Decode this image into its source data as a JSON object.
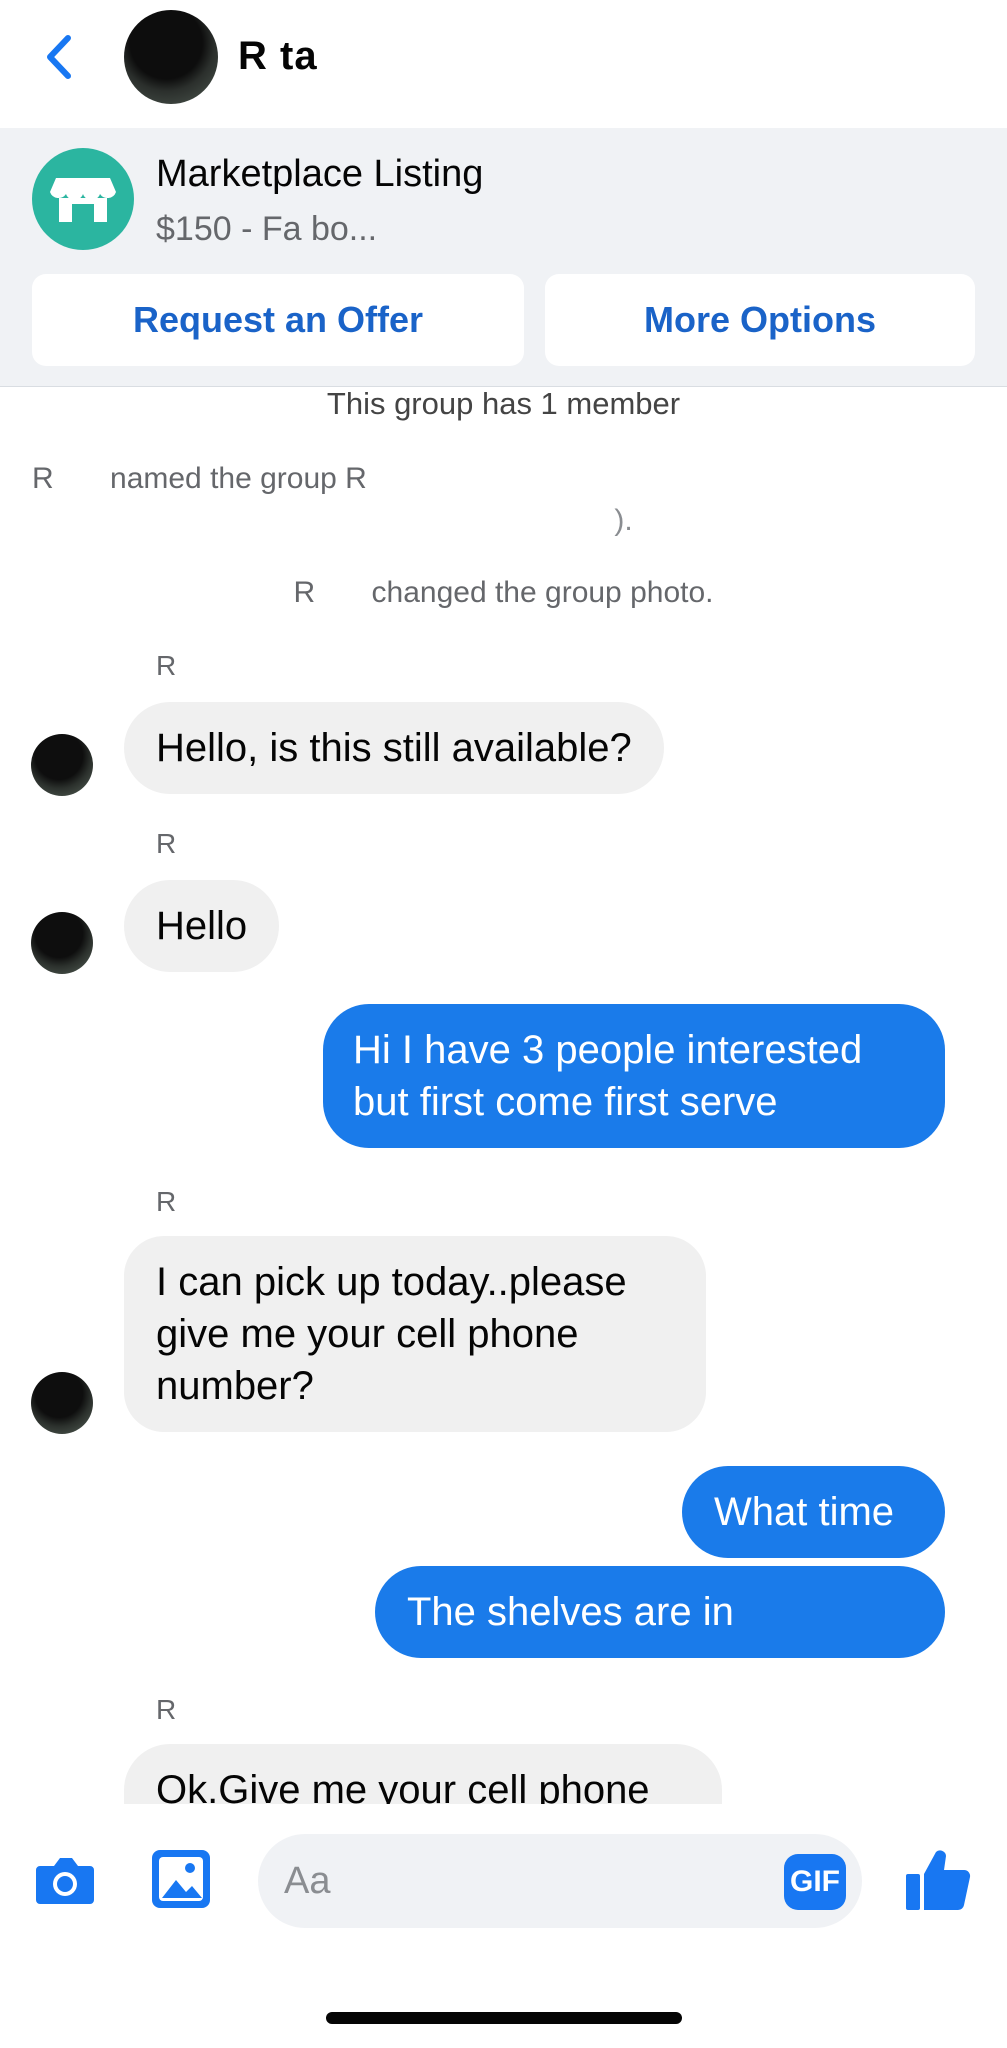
{
  "header": {
    "contact_name": "R        ta",
    "back_icon": "chevron-left-icon",
    "accent": "#1877f2"
  },
  "listing": {
    "title": "Marketplace Listing",
    "subtitle": "$150 - Fa                                       bo...",
    "store_icon": "storefront-icon",
    "buttons": {
      "request_offer": "Request an Offer",
      "more_options": "More Options"
    }
  },
  "system": {
    "members": "This group has 1 member",
    "named_actor": "R",
    "named_text": "named the group R",
    "named_text_2": ").",
    "photo_actor": "R",
    "photo_text": "changed the group photo."
  },
  "messages": [
    {
      "sender": "R",
      "text": "Hello, is this still available?",
      "direction": "in"
    },
    {
      "sender": "R",
      "text": "Hello",
      "direction": "in"
    },
    {
      "text": "Hi I have 3 people interested but first come first serve",
      "direction": "out"
    },
    {
      "sender": "R",
      "text": "I can pick up today..please give me your cell phone number?",
      "direction": "in"
    },
    {
      "text": "What time",
      "direction": "out"
    },
    {
      "text": "The shelves are in",
      "direction": "out"
    },
    {
      "sender": "R",
      "text": "Ok.Give me your cell phone",
      "direction": "in"
    }
  ],
  "composer": {
    "placeholder": "Aa",
    "gif_label": "GIF",
    "camera_icon": "camera-icon",
    "image_icon": "image-icon",
    "like_icon": "thumbs-up-icon"
  },
  "colors": {
    "outgoing_bubble": "#1a7bea",
    "incoming_bubble": "#f0f0f0",
    "listing_bg": "#f0f2f5",
    "store_icon_bg": "#2bb5a0"
  }
}
